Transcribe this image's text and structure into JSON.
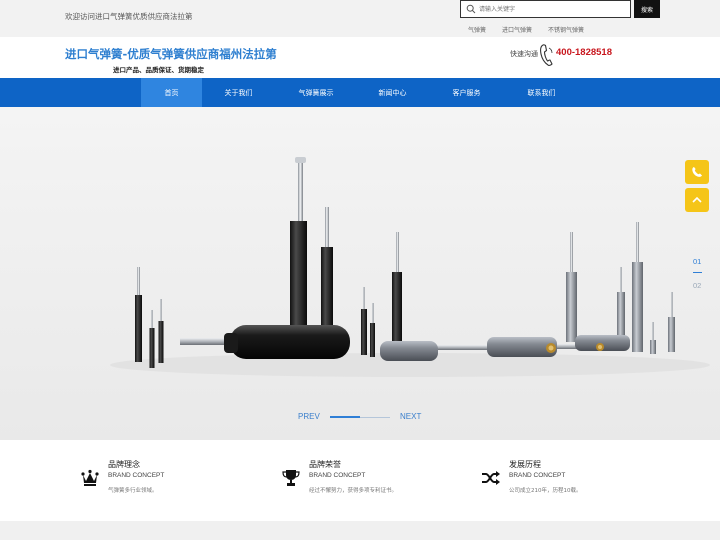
{
  "topbar": {
    "welcome": "欢迎访问进口气弹簧优质供应商法拉第",
    "search": {
      "placeholder": "请输入关键字",
      "button": "搜索"
    },
    "hot_keywords": [
      "气弹簧",
      "进口气弹簧",
      "不锈钢气弹簧"
    ]
  },
  "header": {
    "title": "进口气弹簧-优质气弹簧供应商福州法拉第",
    "slogan": "进口产品、品质保证、货期稳定",
    "hotline_label": "快速沟通",
    "hotline_number": "400-1828518"
  },
  "nav": [
    "首页",
    "关于我们",
    "气弹簧展示",
    "新闻中心",
    "客户服务",
    "联系我们"
  ],
  "banner": {
    "prev": "PREV",
    "next": "NEXT",
    "slides": [
      "01",
      "02"
    ],
    "current_slide": 1
  },
  "features": [
    {
      "icon": "crown-icon",
      "title": "品牌理念",
      "subtitle": "BRAND CONCEPT",
      "desc": "气弹簧多行业领域。"
    },
    {
      "icon": "trophy-icon",
      "title": "品牌荣誉",
      "subtitle": "BRAND CONCEPT",
      "desc": "经过不懈努力，获得多项专利证书。"
    },
    {
      "icon": "shuffle-icon",
      "title": "发展历程",
      "subtitle": "BRAND CONCEPT",
      "desc": "公司成立210年，历程10载。"
    }
  ],
  "colors": {
    "brand_blue": "#0e64c6",
    "nav_active": "#2f85e0",
    "title_blue": "#2e7fd0",
    "hotline_red": "#c8161d",
    "float_yellow": "#f5c518"
  }
}
